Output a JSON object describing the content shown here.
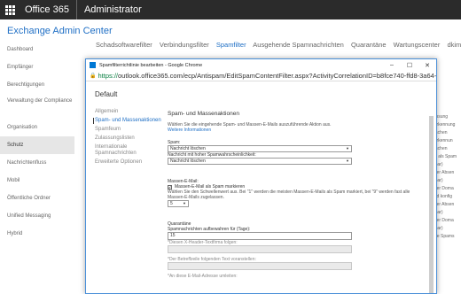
{
  "o365": {
    "title": "Office 365",
    "section": "Administrator"
  },
  "eac": {
    "title": "Exchange Admin Center"
  },
  "left_nav": [
    "Dashboard",
    "Empfänger",
    "Berechtigungen",
    "Verwaltung der Compliance",
    "Organisation",
    "Schutz",
    "Nachrichtenfluss",
    "Mobil",
    "Öffentliche Ordner",
    "Unified Messaging",
    "Hybrid"
  ],
  "tabs": [
    "Schadsoftwarefilter",
    "Verbindungsfilter",
    "Spamfilter",
    "Ausgehende Spamnachrichten",
    "Quarantäne",
    "Wartungscenter",
    "dkim"
  ],
  "bg_right": [
    "sse",
    "enfassung",
    "für Erkennung",
    "ts löschen",
    "für Erkennun",
    "ts löschen",
    "-Mail als Spam",
    "rfügbar)",
    "eichter Absen",
    "rfügbar)",
    "eichter Doma",
    "n sind konfig",
    "eichter Absen",
    "rfügbar)",
    "eichter Doma",
    "rfügbar)",
    "immte Spams"
  ],
  "dialog": {
    "title": "Spamfilterrichtlinie bearbeiten - Google Chrome",
    "url_https": "https://",
    "url_rest": "outlook.office365.com/ecp/Antispam/EditSpamContentFilter.aspx?ActivityCorrelationID=b8fce740-ffd8-3a64-e1ab-",
    "heading": "Default",
    "nav": [
      "Allgemein",
      "Spam- und Massenaktionen",
      "Spamfeum",
      "Zulassungslisten",
      "Internationale Spamnachrichten",
      "Erweiterte Optionen"
    ],
    "section_title": "Spam- und Massenaktionen",
    "section_desc": "Wählen Sie die eingehende Spam- und Massen-E-Mails auszuführende Aktion aus.",
    "more_info": "Weitere Informationen",
    "spam_label": "Spam:",
    "spam_value": "Nachricht löschen",
    "high_conf_label": "Nachricht mit hoher Spamwahrscheinlichkeit:",
    "high_conf_value": "Nachricht löschen",
    "bulk_title": "Massen-E-Mail:",
    "bulk_check_label": "Massen-E-Mail als Spam markieren",
    "bulk_desc": "Wählen Sie den Schwellenwert aus. Bei \"1\" werden die meisten Massen-E-Mails als Spam markiert, bei \"9\" werden fast alle Massen-E-Mails zugelassen.",
    "bulk_threshold": "5",
    "quarantine_title": "Quarantäne",
    "retention_label": "Spamnachrichten aufbewahren für (Tage):",
    "retention_value": "15",
    "xheader_label": "*Diesen X-Header-Textfirma folgen:",
    "subject_label": "*Der Betreffzeile folgenden Text voranstellen:",
    "redirect_label": "*An diese E-Mail-Adresse umleiten:"
  }
}
